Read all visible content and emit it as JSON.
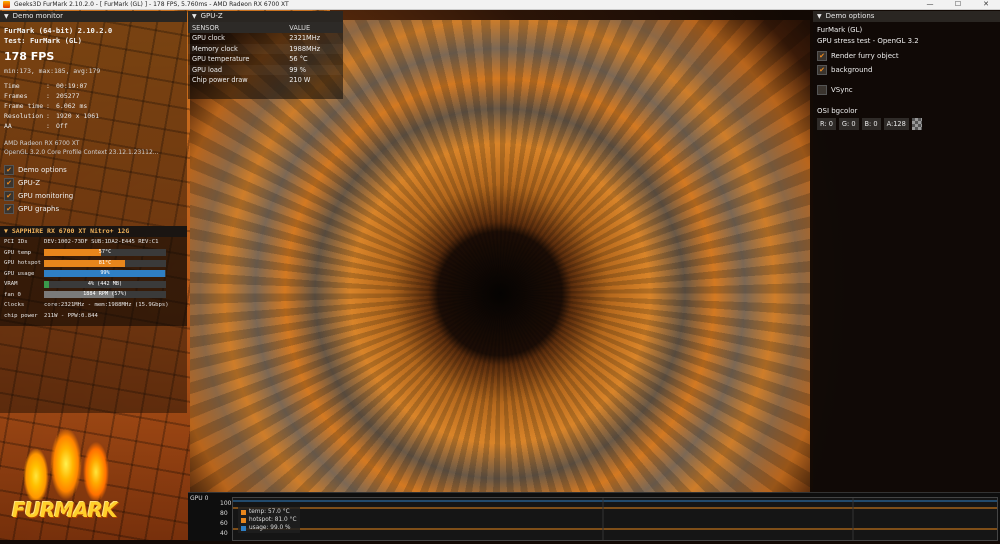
{
  "window": {
    "title": "Geeks3D FurMark 2.10.2.0 - [ FurMark (GL) ] - 178 FPS, 5.760ms - AMD Radeon RX 6700 XT",
    "minimize": "—",
    "maximize": "☐",
    "close": "✕"
  },
  "demo_monitor": {
    "header": "Demo monitor",
    "app_title": "FurMark (64-bit) 2.10.2.0",
    "test": "Test: FurMark (GL)",
    "fps": "178 FPS",
    "minmax": "min:173, max:185, avg:179",
    "stats": [
      {
        "key": "Time",
        "sep": ":",
        "value": "00:19:07"
      },
      {
        "key": "Frames",
        "sep": ":",
        "value": "205277"
      },
      {
        "key": "Frame time",
        "sep": ":",
        "value": "6.062 ms"
      },
      {
        "key": "Resolution",
        "sep": ":",
        "value": "1920 x 1061"
      },
      {
        "key": "AA",
        "sep": ":",
        "value": "Off"
      }
    ],
    "gpu_name": "AMD Radeon RX 6700 XT",
    "gl_info": "OpenGL 3.2.0 Core Profile Context 23.12.1.23112...",
    "checks": [
      {
        "label": "Demo options",
        "checked": true
      },
      {
        "label": "GPU-Z",
        "checked": true
      },
      {
        "label": "GPU monitoring",
        "checked": true
      },
      {
        "label": "GPU graphs",
        "checked": true
      }
    ]
  },
  "sapphire": {
    "header": "▼ SAPPHIRE RX 6700 XT Nitro+ 12G",
    "pci_label": "PCI IDs",
    "pci_value": "DEV:1002-73DF SUB:1DA2-E445 REV:C1",
    "bars": [
      {
        "label": "GPU temp",
        "text": "57°C",
        "fraction": 0.47,
        "color": "#e8861c"
      },
      {
        "label": "GPU hotspot",
        "text": "81°C",
        "fraction": 0.66,
        "color": "#e8861c"
      },
      {
        "label": "GPU usage",
        "text": "99%",
        "fraction": 0.99,
        "color": "#2f7fc4"
      },
      {
        "label": "VRAM",
        "text": "4% (442 MB)",
        "fraction": 0.04,
        "color": "#3a9a4a"
      },
      {
        "label": "fan 0",
        "text": "1884 RPM (57%)",
        "fraction": 0.57,
        "color": "#7a7a7a"
      }
    ],
    "clocks_label": "Clocks",
    "clocks_value": "core:2321MHz - mem:1988MHz (15.9Gbps)",
    "power_label": "chip power",
    "power_value": "211W - PPW:0.844"
  },
  "gpuz": {
    "header": "GPU-Z",
    "col_sensor": "SENSOR",
    "col_value": "VALUE",
    "rows": [
      {
        "sensor": "GPU clock",
        "value": "2321MHz"
      },
      {
        "sensor": "Memory clock",
        "value": "1988MHz"
      },
      {
        "sensor": "GPU temperature",
        "value": "56 °C"
      },
      {
        "sensor": "GPU load",
        "value": "99 %"
      },
      {
        "sensor": "Chip power draw",
        "value": "210 W"
      }
    ]
  },
  "demo_options": {
    "header": "Demo options",
    "name": "FurMark (GL)",
    "desc": "GPU stress test - OpenGL 3.2",
    "checks": [
      {
        "label": "Render furry object",
        "checked": true
      },
      {
        "label": "background",
        "checked": true
      }
    ],
    "vsync": {
      "label": "VSync",
      "checked": false
    },
    "bgcolor_label": "OSI bgcolor",
    "bgcolor": {
      "r": "R: 0",
      "g": "G: 0",
      "b": "B: 0",
      "a": "A:128"
    }
  },
  "graph": {
    "label": "GPU 0",
    "yticks": [
      "100",
      "80",
      "60",
      "40"
    ],
    "legend": [
      {
        "text": "temp: 57.0 °C",
        "color": "#e8861c"
      },
      {
        "text": "hotspot: 81.0 °C",
        "color": "#e8861c"
      },
      {
        "text": "usage: 99.0 %",
        "color": "#2f7fc4"
      }
    ]
  },
  "logo": {
    "text": "FURMARK"
  }
}
